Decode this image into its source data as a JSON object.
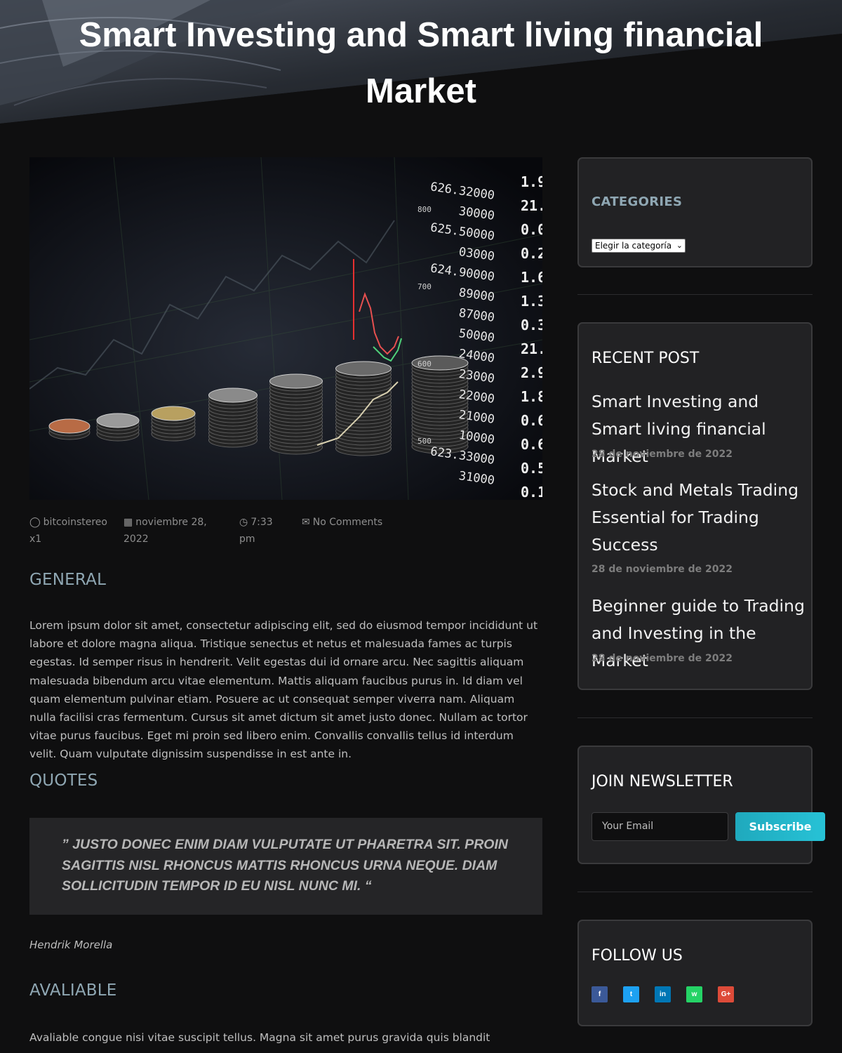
{
  "page": {
    "title": "Smart Investing and Smart living financial Market"
  },
  "post": {
    "meta": {
      "author": "bitcoinstereo x1",
      "date": "noviembre 28, 2022",
      "time": "7:33 pm",
      "comments": "No Comments"
    },
    "general_heading": "GENERAL",
    "general_text": "Lorem ipsum dolor sit amet, consectetur adipiscing elit, sed do eiusmod tempor incididunt ut labore et dolore magna aliqua. Tristique senectus et netus et malesuada fames ac turpis egestas. Id semper risus in hendrerit. Velit egestas dui id ornare arcu. Nec sagittis aliquam malesuada bibendum arcu vitae elementum. Mattis aliquam faucibus purus in. Id diam vel quam elementum pulvinar etiam. Posuere ac ut consequat semper viverra nam. Aliquam nulla facilisi cras fermentum. Cursus sit amet dictum sit amet justo donec. Nullam ac tortor vitae purus faucibus. Eget mi proin sed libero enim. Convallis convallis tellus id interdum velit. Quam vulputate dignissim suspendisse in est ante in.",
    "quotes_heading": "QUOTES",
    "quote_text": "” JUSTO DONEC ENIM DIAM VULPUTATE UT PHARETRA SIT. PROIN SAGITTIS NISL RHONCUS MATTIS RHONCUS URNA NEQUE. DIAM SOLLICITUDIN TEMPOR ID EU NISL NUNC MI. “",
    "quote_author": "Hendrik Morella",
    "available_heading": "AVALIABLE",
    "available_text": "Avaliable congue nisi vitae suscipit tellus. Magna sit amet purus gravida quis blandit",
    "image_numbers": [
      "626.32000",
      "30000",
      "625.50000",
      "03000",
      "624.90000",
      "89000",
      "87000",
      "50000",
      "24000",
      "23000",
      "22000",
      "21000",
      "10000",
      "623.33000",
      "31000"
    ],
    "image_right_numbers": [
      "1.9",
      "21.",
      "0.0",
      "0.2",
      "1.6",
      "1.3",
      "0.3",
      "21.",
      "2.9",
      "1.8",
      "0.6",
      "0.6",
      "0.5",
      "0.1"
    ],
    "image_axis_labels": [
      "800",
      "700",
      "600",
      "500"
    ]
  },
  "sidebar": {
    "categories": {
      "title": "CATEGORIES",
      "select_value": "Elegir la categoría"
    },
    "recent": {
      "title": "RECENT POST",
      "items": [
        {
          "title": "Smart Investing and Smart living financial Market",
          "date": "28 de noviembre de 2022"
        },
        {
          "title": "Stock and Metals Trading Essential for Trading Success",
          "date": "28 de noviembre de 2022"
        },
        {
          "title": "Beginner guide to Trading and Investing in the Market",
          "date": "28 de noviembre de 2022"
        }
      ]
    },
    "newsletter": {
      "title": "JOIN NEWSLETTER",
      "email_placeholder": "Your Email",
      "subscribe_label": "Subscribe"
    },
    "follow": {
      "title": "FOLLOW US",
      "icons": [
        {
          "name": "facebook-icon",
          "color": "#3b5998",
          "glyph": "f"
        },
        {
          "name": "twitter-icon",
          "color": "#1da1f2",
          "glyph": "t"
        },
        {
          "name": "linkedin-icon",
          "color": "#0077b5",
          "glyph": "in"
        },
        {
          "name": "whatsapp-icon",
          "color": "#25d366",
          "glyph": "w"
        },
        {
          "name": "google-plus-icon",
          "color": "#dd4b39",
          "glyph": "G+"
        }
      ]
    }
  }
}
